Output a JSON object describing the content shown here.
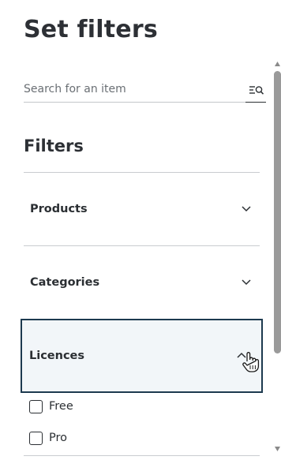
{
  "header": {
    "title": "Set filters"
  },
  "search": {
    "placeholder": "Search for an item",
    "value": "",
    "icon": "list-search-icon"
  },
  "filters": {
    "heading": "Filters",
    "sections": [
      {
        "label": "Products",
        "expanded": false,
        "icon": "chevron-down-icon"
      },
      {
        "label": "Categories",
        "expanded": false,
        "icon": "chevron-down-icon"
      },
      {
        "label": "Licences",
        "expanded": true,
        "icon": "chevron-up-icon",
        "options": [
          {
            "label": "Free",
            "checked": false
          },
          {
            "label": "Pro",
            "checked": false
          }
        ]
      }
    ]
  },
  "colors": {
    "text": "#2b2f33",
    "active_border": "#1d3a4f",
    "active_bg": "#f2f6f9",
    "divider": "#c9ccd0",
    "scrollbar": "#9a9a9a"
  }
}
